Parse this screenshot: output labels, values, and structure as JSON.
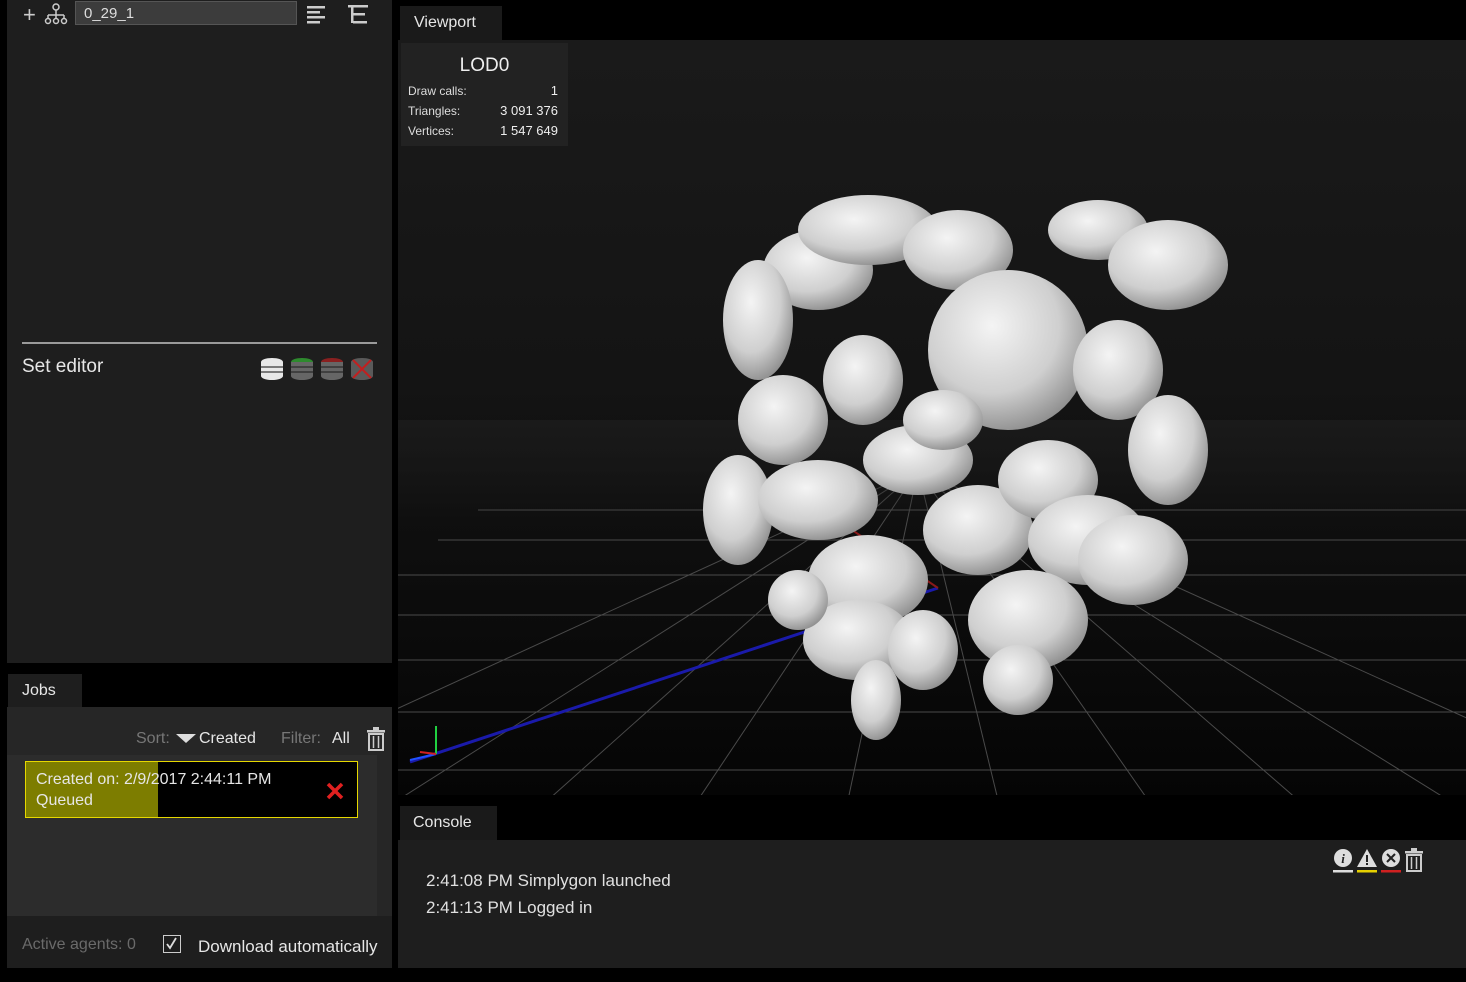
{
  "scene_tree": {
    "add_label": "+",
    "scene_name": "0_29_1"
  },
  "set_editor": {
    "title": "Set editor"
  },
  "jobs": {
    "tab_label": "Jobs",
    "sort_label": "Sort:",
    "sort_value": "Created",
    "filter_label": "Filter:",
    "filter_value": "All",
    "items": [
      {
        "created": "Created on: 2/9/2017 2:44:11 PM",
        "status": "Queued",
        "progress": 0.4
      }
    ],
    "active_agents": "Active agents: 0",
    "download_label": "Download automatically",
    "download_checked": true
  },
  "viewport": {
    "tab_label": "Viewport",
    "lod_title": "LOD0",
    "stats": [
      {
        "label": "Draw calls:",
        "value": "1"
      },
      {
        "label": "Triangles:",
        "value": "3 091 376"
      },
      {
        "label": "Vertices:",
        "value": "1 547 649"
      }
    ]
  },
  "console": {
    "tab_label": "Console",
    "lines": [
      "2:41:08 PM Simplygon launched",
      "2:41:13 PM Logged in"
    ]
  },
  "colors": {
    "panel_bg": "#1e1e1e",
    "job_border": "#e6d800",
    "job_progress": "#7d7d00",
    "delete_x": "#e02020"
  }
}
